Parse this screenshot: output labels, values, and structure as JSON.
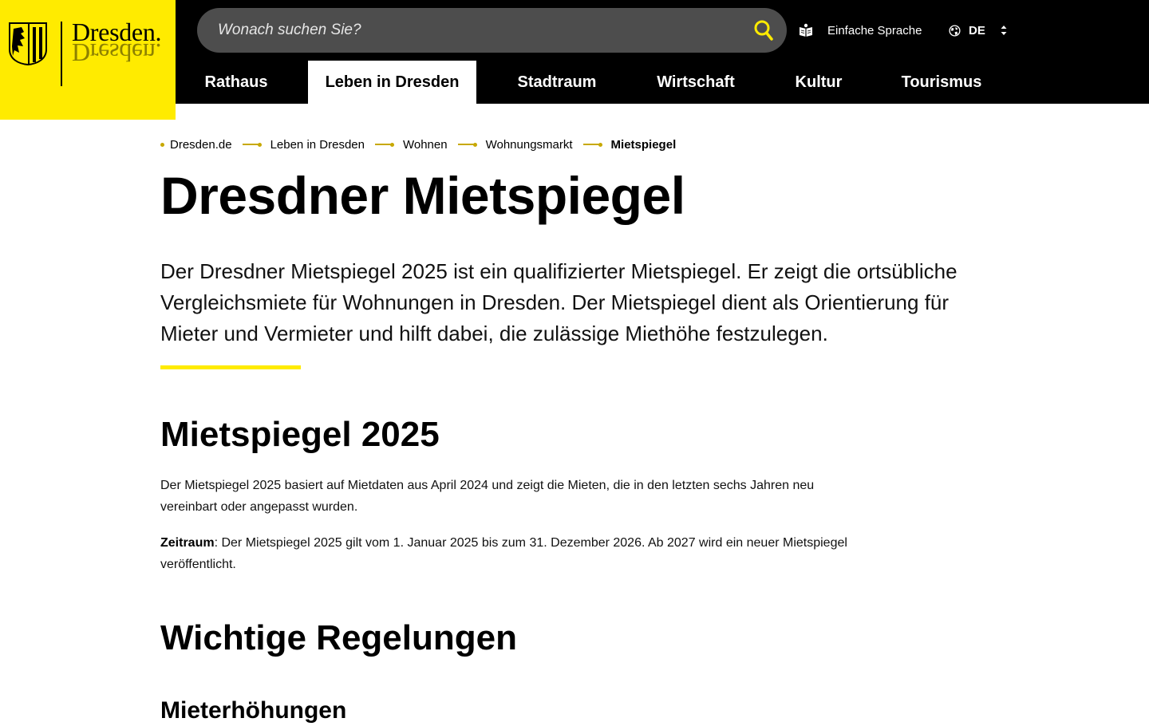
{
  "brand": {
    "logo_text": "Dresden.",
    "accent_color": "#ffeb00",
    "header_color": "#000000"
  },
  "search": {
    "placeholder": "Wonach suchen Sie?",
    "icon": "search-icon"
  },
  "utility": {
    "easy_language_label": "Einfache Sprache",
    "easy_language_icon": "easy-language-icon",
    "language_code": "DE",
    "language_icon": "globe-icon"
  },
  "nav": {
    "items": [
      {
        "label": "Rathaus"
      },
      {
        "label": "Leben in Dresden",
        "active": true
      },
      {
        "label": "Stadtraum"
      },
      {
        "label": "Wirtschaft"
      },
      {
        "label": "Kultur"
      },
      {
        "label": "Tourismus"
      }
    ]
  },
  "breadcrumb": {
    "items": [
      "Dresden.de",
      "Leben in Dresden",
      "Wohnen",
      "Wohnungsmarkt"
    ],
    "current": "Mietspiegel"
  },
  "page": {
    "title": "Dresdner Mietspiegel",
    "lead": "Der Dresdner Mietspiegel 2025 ist ein qualifizierter Mietspiegel. Er zeigt die ortsübliche Vergleichsmiete für Wohnungen in Dresden. Der Mietspiegel dient als Orientierung für Mieter und Vermieter und hilft dabei, die zulässige Miethöhe festzulegen."
  },
  "section1": {
    "heading": "Mietspiegel 2025",
    "paragraph1": "Der Mietspiegel 2025 basiert auf Mietdaten aus April 2024 und zeigt die Mieten, die in den letzten sechs Jahren neu vereinbart oder angepasst wurden.",
    "paragraph2_label": "Zeitraum",
    "paragraph2_text": ": Der Mietspiegel 2025 gilt vom 1. Januar 2025 bis zum 31. Dezember 2026. Ab 2027 wird ein neuer Miet­spiegel veröffentlicht."
  },
  "section2": {
    "heading": "Wichtige Regelungen",
    "subheading": "Mieterhöhungen"
  }
}
